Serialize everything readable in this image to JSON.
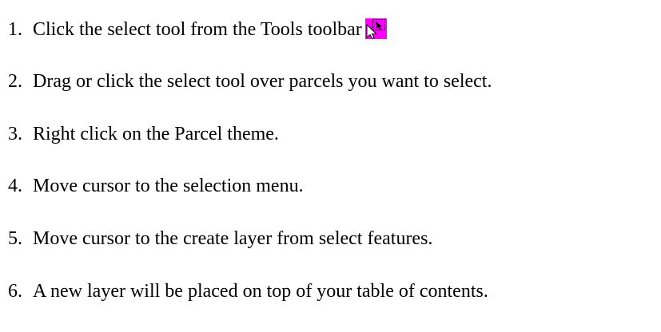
{
  "steps": [
    {
      "number": "1.",
      "text": "Click the select tool from the Tools toolbar",
      "icon": "select-tool-icon"
    },
    {
      "number": "2.",
      "text": "Drag or click the select tool over parcels you want to select."
    },
    {
      "number": "3.",
      "text": "Right click on the Parcel theme."
    },
    {
      "number": "4.",
      "text": "Move cursor to the selection menu."
    },
    {
      "number": "5.",
      "text": "Move cursor to the create layer from select features."
    },
    {
      "number": "6.",
      "text": "A new layer will be placed on top of your table of contents."
    }
  ],
  "colors": {
    "icon_background": "#ff00ff",
    "icon_foreground": "#000000",
    "text": "#000000"
  }
}
